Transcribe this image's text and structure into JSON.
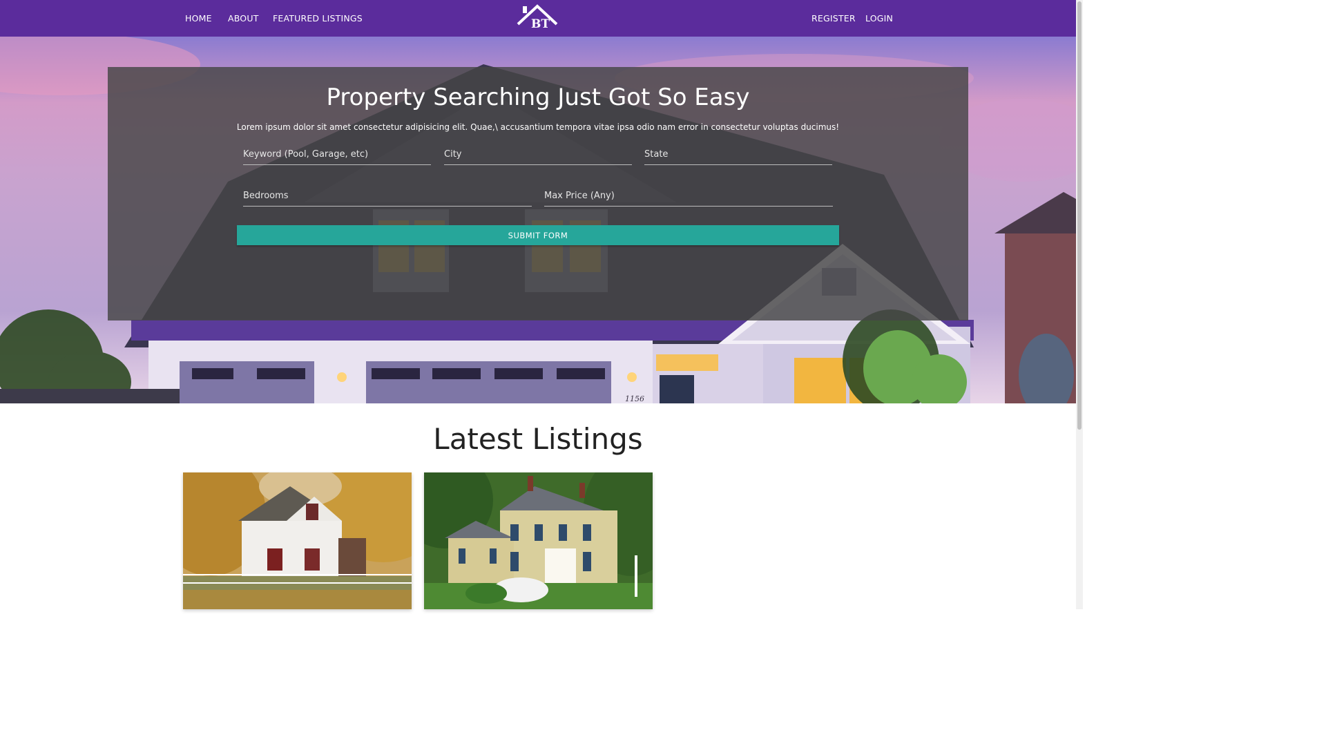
{
  "nav": {
    "left_links": [
      "HOME",
      "ABOUT",
      "FEATURED LISTINGS"
    ],
    "right_links": [
      "REGISTER",
      "LOGIN"
    ],
    "logo_text": "BT",
    "color": "#5b2c9c"
  },
  "search": {
    "title": "Property Searching Just Got So Easy",
    "subtitle": "Lorem ipsum dolor sit amet consectetur adipisicing elit. Quae,\\ accusantium tempora vitae ipsa odio nam error in consectetur voluptas ducimus!",
    "keyword_placeholder": "Keyword (Pool, Garage, etc)",
    "city_placeholder": "City",
    "state_placeholder": "State",
    "bedrooms_placeholder": "Bedrooms",
    "max_price_placeholder": "Max Price (Any)",
    "submit_label": "SUBMIT FORM",
    "button_color": "#26a69a"
  },
  "listings": {
    "title": "Latest Listings",
    "cards": [
      {
        "image": "white-farmhouse-autumn-photo"
      },
      {
        "image": "beige-colonial-house-photo"
      }
    ]
  },
  "hero": {
    "house_number": "1156"
  }
}
